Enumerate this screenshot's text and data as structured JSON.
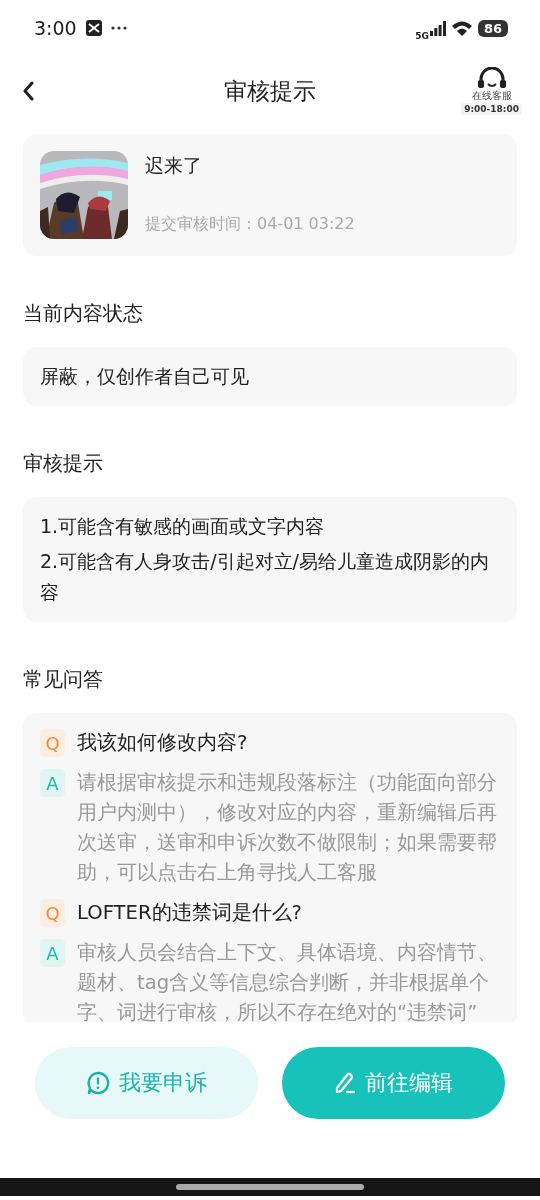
{
  "status_bar": {
    "time": "3:00",
    "network": "5G",
    "battery": "86"
  },
  "header": {
    "title": "审核提示",
    "service_label": "在线客服",
    "service_hours": "9:00-18:00"
  },
  "post": {
    "title": "迟来了",
    "submitted": "提交审核时间：04-01 03:22"
  },
  "sections": [
    {
      "kind": "status",
      "title": "当前内容状态",
      "lines": [
        "屏蔽，仅创作者自己可见"
      ]
    },
    {
      "kind": "notes",
      "title": "审核提示",
      "lines": [
        "1.可能含有敏感的画面或文字内容",
        "2.可能含有人身攻击/引起对立/易给儿童造成阴影的内容"
      ]
    },
    {
      "kind": "faq",
      "title": "常见问答",
      "items": [
        {
          "kind": "q",
          "badge": "Q",
          "text": "我该如何修改内容?"
        },
        {
          "kind": "a",
          "badge": "A",
          "text": "请根据审核提示和违规段落标注（功能面向部分用户内测中），修改对应的内容，重新编辑后再次送审，送审和申诉次数不做限制；如果需要帮助，可以点击右上角寻找人工客服"
        },
        {
          "kind": "q",
          "badge": "Q",
          "text": "LOFTER的违禁词是什么?"
        },
        {
          "kind": "a",
          "badge": "A",
          "text": "审核人员会结合上下文、具体语境、内容情节、题材、tag含义等信息综合判断，并非根据单个字、词进行审核，所以不存在绝对的“违禁词”"
        }
      ]
    }
  ],
  "buttons": [
    {
      "kind": "appeal",
      "label": "我要申诉"
    },
    {
      "kind": "edit",
      "label": "前往编辑"
    }
  ]
}
